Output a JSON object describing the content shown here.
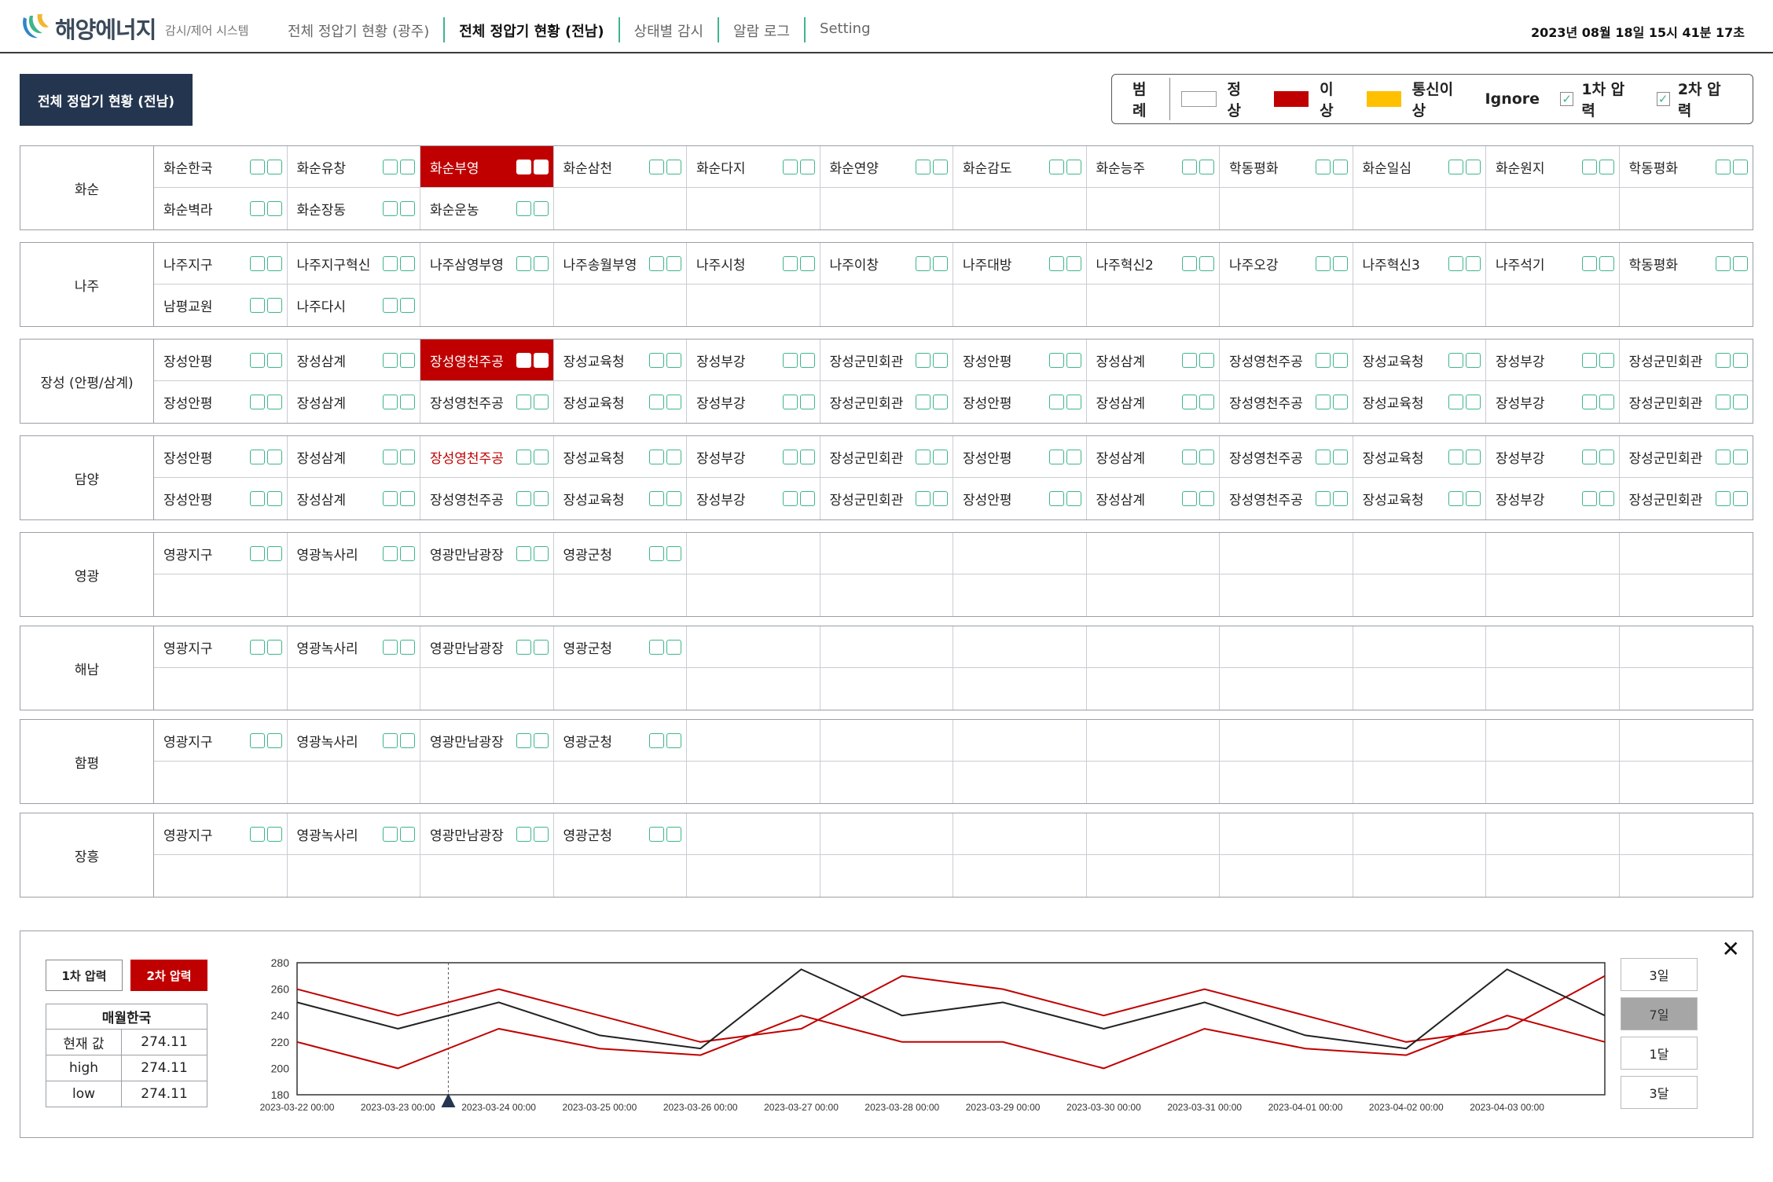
{
  "brand": {
    "name": "해양에너지",
    "subtitle": "감시/제어 시스템"
  },
  "nav": [
    {
      "label": "전체 정압기 현황 (광주)",
      "active": false
    },
    {
      "label": "전체 정압기 현황 (전남)",
      "active": true
    },
    {
      "label": "상태별 감시",
      "active": false
    },
    {
      "label": "알람 로그",
      "active": false
    },
    {
      "label": "Setting",
      "active": false
    }
  ],
  "clock": "2023년 08월 18일 15시 41분 17초",
  "page_title": "전체 정압기 현황 (전남)",
  "legend": {
    "title": "범례",
    "items": [
      {
        "label": "정상",
        "color": "#ffffff"
      },
      {
        "label": "이상",
        "color": "#c00000"
      },
      {
        "label": "통신이상",
        "color": "#ffc000"
      }
    ],
    "ignore": "Ignore",
    "checks": [
      {
        "label": "1차 압력",
        "checked": true
      },
      {
        "label": "2차 압력",
        "checked": true
      }
    ]
  },
  "colors": {
    "alarm": "#c00000",
    "ok_box": "#3fb58a",
    "comm_error": "#ffc000",
    "title_bg": "#24364f"
  },
  "regions": [
    {
      "name": "화순",
      "rows": [
        [
          "화순한국",
          "화순유창",
          "화순부영",
          "화순삼천",
          "화순다지",
          "화순연양",
          "화순감도",
          "화순능주",
          "학동평화",
          "화순일심",
          "화순원지",
          "학동평화"
        ],
        [
          "화순벽라",
          "화순장동",
          "화순운농",
          "",
          "",
          "",
          "",
          "",
          "",
          "",
          "",
          ""
        ]
      ],
      "alarm_cells": [
        "0-2"
      ],
      "alarm_text_cells": []
    },
    {
      "name": "나주",
      "rows": [
        [
          "나주지구",
          "나주지구혁신",
          "나주삼영부영",
          "나주송월부영",
          "나주시청",
          "나주이창",
          "나주대방",
          "나주혁신2",
          "나주오강",
          "나주혁신3",
          "나주석기",
          "학동평화"
        ],
        [
          "남평교원",
          "나주다시",
          "",
          "",
          "",
          "",
          "",
          "",
          "",
          "",
          "",
          ""
        ]
      ],
      "alarm_cells": [],
      "alarm_text_cells": []
    },
    {
      "name": "장성 (안평/삼계)",
      "rows": [
        [
          "장성안평",
          "장성삼계",
          "장성영천주공",
          "장성교육청",
          "장성부강",
          "장성군민회관",
          "장성안평",
          "장성삼계",
          "장성영천주공",
          "장성교육청",
          "장성부강",
          "장성군민회관"
        ],
        [
          "장성안평",
          "장성삼계",
          "장성영천주공",
          "장성교육청",
          "장성부강",
          "장성군민회관",
          "장성안평",
          "장성삼계",
          "장성영천주공",
          "장성교육청",
          "장성부강",
          "장성군민회관"
        ]
      ],
      "alarm_cells": [
        "0-2"
      ],
      "alarm_text_cells": []
    },
    {
      "name": "담양",
      "rows": [
        [
          "장성안평",
          "장성삼계",
          "장성영천주공",
          "장성교육청",
          "장성부강",
          "장성군민회관",
          "장성안평",
          "장성삼계",
          "장성영천주공",
          "장성교육청",
          "장성부강",
          "장성군민회관"
        ],
        [
          "장성안평",
          "장성삼계",
          "장성영천주공",
          "장성교육청",
          "장성부강",
          "장성군민회관",
          "장성안평",
          "장성삼계",
          "장성영천주공",
          "장성교육청",
          "장성부강",
          "장성군민회관"
        ]
      ],
      "alarm_cells": [],
      "alarm_text_cells": [
        "0-2"
      ]
    },
    {
      "name": "영광",
      "rows": [
        [
          "영광지구",
          "영광녹사리",
          "영광만남광장",
          "영광군청",
          "",
          "",
          "",
          "",
          "",
          "",
          "",
          ""
        ],
        [
          "",
          "",
          "",
          "",
          "",
          "",
          "",
          "",
          "",
          "",
          "",
          ""
        ]
      ],
      "alarm_cells": [],
      "alarm_text_cells": []
    },
    {
      "name": "해남",
      "rows": [
        [
          "영광지구",
          "영광녹사리",
          "영광만남광장",
          "영광군청",
          "",
          "",
          "",
          "",
          "",
          "",
          "",
          ""
        ],
        [
          "",
          "",
          "",
          "",
          "",
          "",
          "",
          "",
          "",
          "",
          "",
          ""
        ]
      ],
      "alarm_cells": [],
      "alarm_text_cells": []
    },
    {
      "name": "함평",
      "rows": [
        [
          "영광지구",
          "영광녹사리",
          "영광만남광장",
          "영광군청",
          "",
          "",
          "",
          "",
          "",
          "",
          "",
          ""
        ],
        [
          "",
          "",
          "",
          "",
          "",
          "",
          "",
          "",
          "",
          "",
          "",
          ""
        ]
      ],
      "alarm_cells": [],
      "alarm_text_cells": []
    },
    {
      "name": "장흥",
      "rows": [
        [
          "영광지구",
          "영광녹사리",
          "영광만남광장",
          "영광군청",
          "",
          "",
          "",
          "",
          "",
          "",
          "",
          ""
        ],
        [
          "",
          "",
          "",
          "",
          "",
          "",
          "",
          "",
          "",
          "",
          "",
          ""
        ]
      ],
      "alarm_cells": [],
      "alarm_text_cells": []
    }
  ],
  "detail": {
    "buttons": {
      "p1": "1차 압력",
      "p2": "2차 압력"
    },
    "station": "매월한국",
    "rows": [
      {
        "label": "현재 값",
        "value": "274.11"
      },
      {
        "label": "high",
        "value": "274.11"
      },
      {
        "label": "low",
        "value": "274.11"
      }
    ],
    "ranges": [
      {
        "label": "3일",
        "active": false
      },
      {
        "label": "7일",
        "active": true
      },
      {
        "label": "1달",
        "active": false
      },
      {
        "label": "3달",
        "active": false
      }
    ]
  },
  "chart_data": {
    "type": "line",
    "x": [
      "2023-03-22 00:00",
      "2023-03-23 00:00",
      "2023-03-24 00:00",
      "2023-03-25 00:00",
      "2023-03-26 00:00",
      "2023-03-27 00:00",
      "2023-03-28 00:00",
      "2023-03-29 00:00",
      "2023-03-30 00:00",
      "2023-03-31 00:00",
      "2023-04-01 00:00",
      "2023-04-02 00:00",
      "2023-04-03 00:00",
      "2023-04-03 12:00"
    ],
    "xticks": [
      "2023-03-22 00:00",
      "2023-03-23 00:00",
      "2023-03-24 00:00",
      "2023-03-25 00:00",
      "2023-03-26 00:00",
      "2023-03-27 00:00",
      "2023-03-28 00:00",
      "2023-03-29 00:00",
      "2023-03-30 00:00",
      "2023-03-31 00:00",
      "2023-04-01 00:00",
      "2023-04-02 00:00",
      "2023-04-03 00:00"
    ],
    "yticks": [
      280,
      260,
      240,
      220,
      200,
      180
    ],
    "ylim": [
      180,
      280
    ],
    "series": [
      {
        "color": "#c00000",
        "values": [
          260,
          240,
          260,
          240,
          220,
          230,
          270,
          260,
          240,
          260,
          240,
          220,
          230,
          270
        ]
      },
      {
        "color": "#222222",
        "values": [
          250,
          230,
          250,
          225,
          215,
          275,
          240,
          250,
          230,
          250,
          225,
          215,
          275,
          240
        ]
      },
      {
        "color": "#c00000",
        "values": [
          220,
          200,
          230,
          215,
          210,
          240,
          220,
          220,
          200,
          230,
          215,
          210,
          240,
          220
        ]
      }
    ],
    "marker_x": "2023-03-23 12:00"
  }
}
